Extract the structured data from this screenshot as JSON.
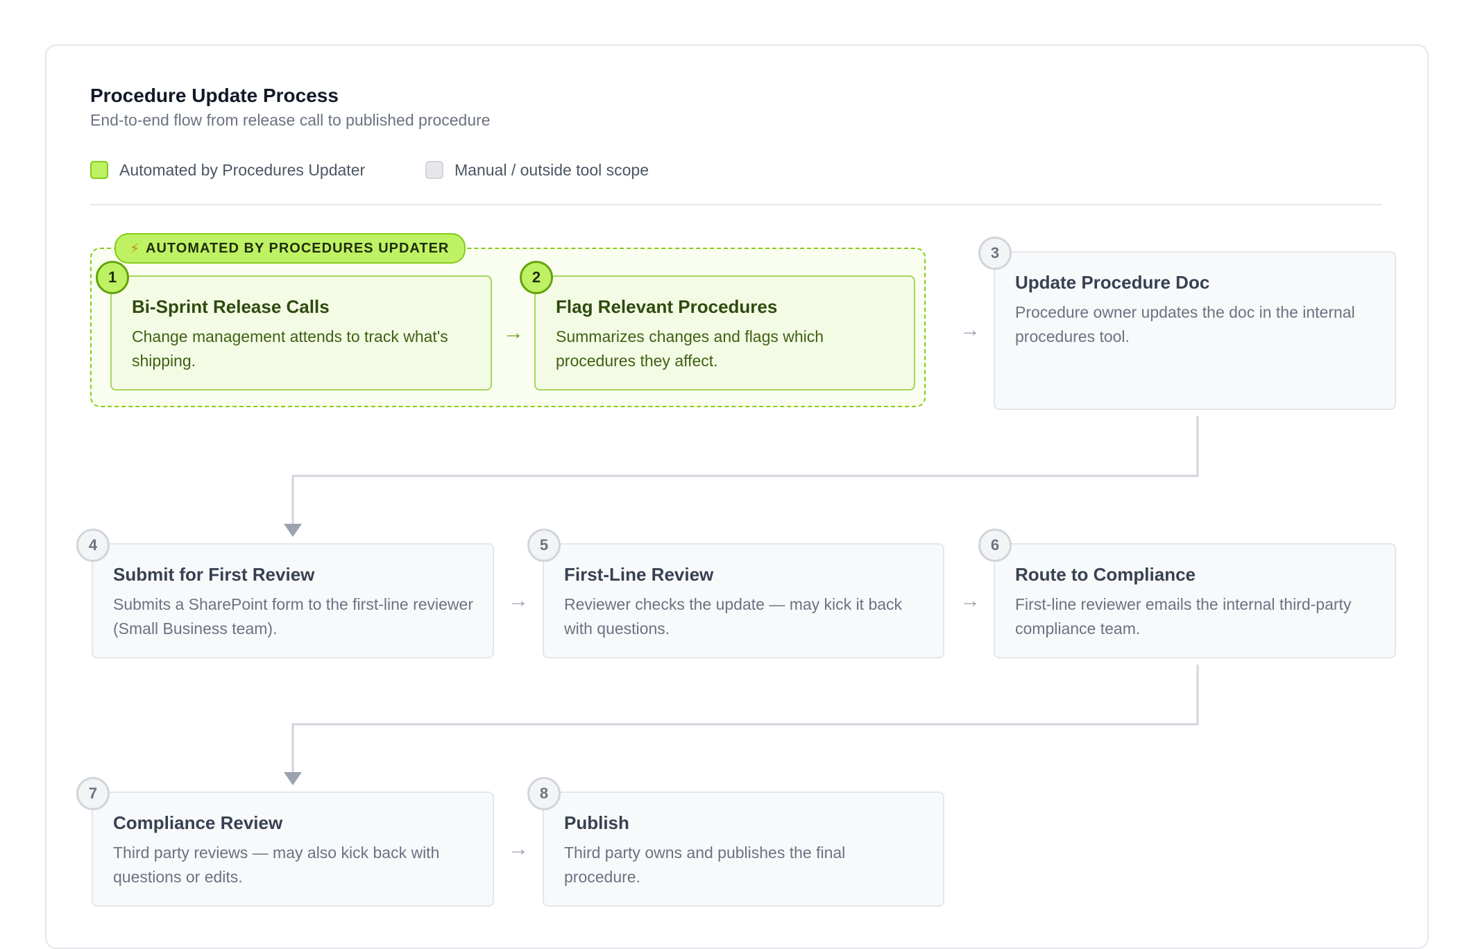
{
  "header": {
    "title": "Procedure Update Process",
    "subtitle": "End-to-end flow from release call to published procedure"
  },
  "legend": {
    "automated_label": "Automated by Procedures Updater",
    "manual_label": "Manual / outside tool scope",
    "colors": {
      "automated": "#bef264",
      "manual": "#e5e7eb"
    }
  },
  "zone": {
    "tag_label": "AUTOMATED BY PROCEDURES UPDATER",
    "tag_icon": "lightning-bolt-icon"
  },
  "arrow_glyph": "→",
  "steps": [
    {
      "num": "1",
      "title": "Bi-Sprint Release Calls",
      "desc": "Change management attends to track what's shipping."
    },
    {
      "num": "2",
      "title": "Flag Relevant Procedures",
      "desc": "Summarizes changes and flags which procedures they affect."
    },
    {
      "num": "3",
      "title": "Update Procedure Doc",
      "desc": "Procedure owner updates the doc in the internal procedures tool."
    },
    {
      "num": "4",
      "title": "Submit for First Review",
      "desc": "Submits a SharePoint form to the first-line reviewer (Small Business team)."
    },
    {
      "num": "5",
      "title": "First-Line Review",
      "desc": "Reviewer checks the update — may kick it back with questions."
    },
    {
      "num": "6",
      "title": "Route to Compliance",
      "desc": "First-line reviewer emails the internal third-party compliance team."
    },
    {
      "num": "7",
      "title": "Compliance Review",
      "desc": "Third party reviews — may also kick back with questions or edits."
    },
    {
      "num": "8",
      "title": "Publish",
      "desc": "Third party owns and publishes the final procedure."
    }
  ]
}
